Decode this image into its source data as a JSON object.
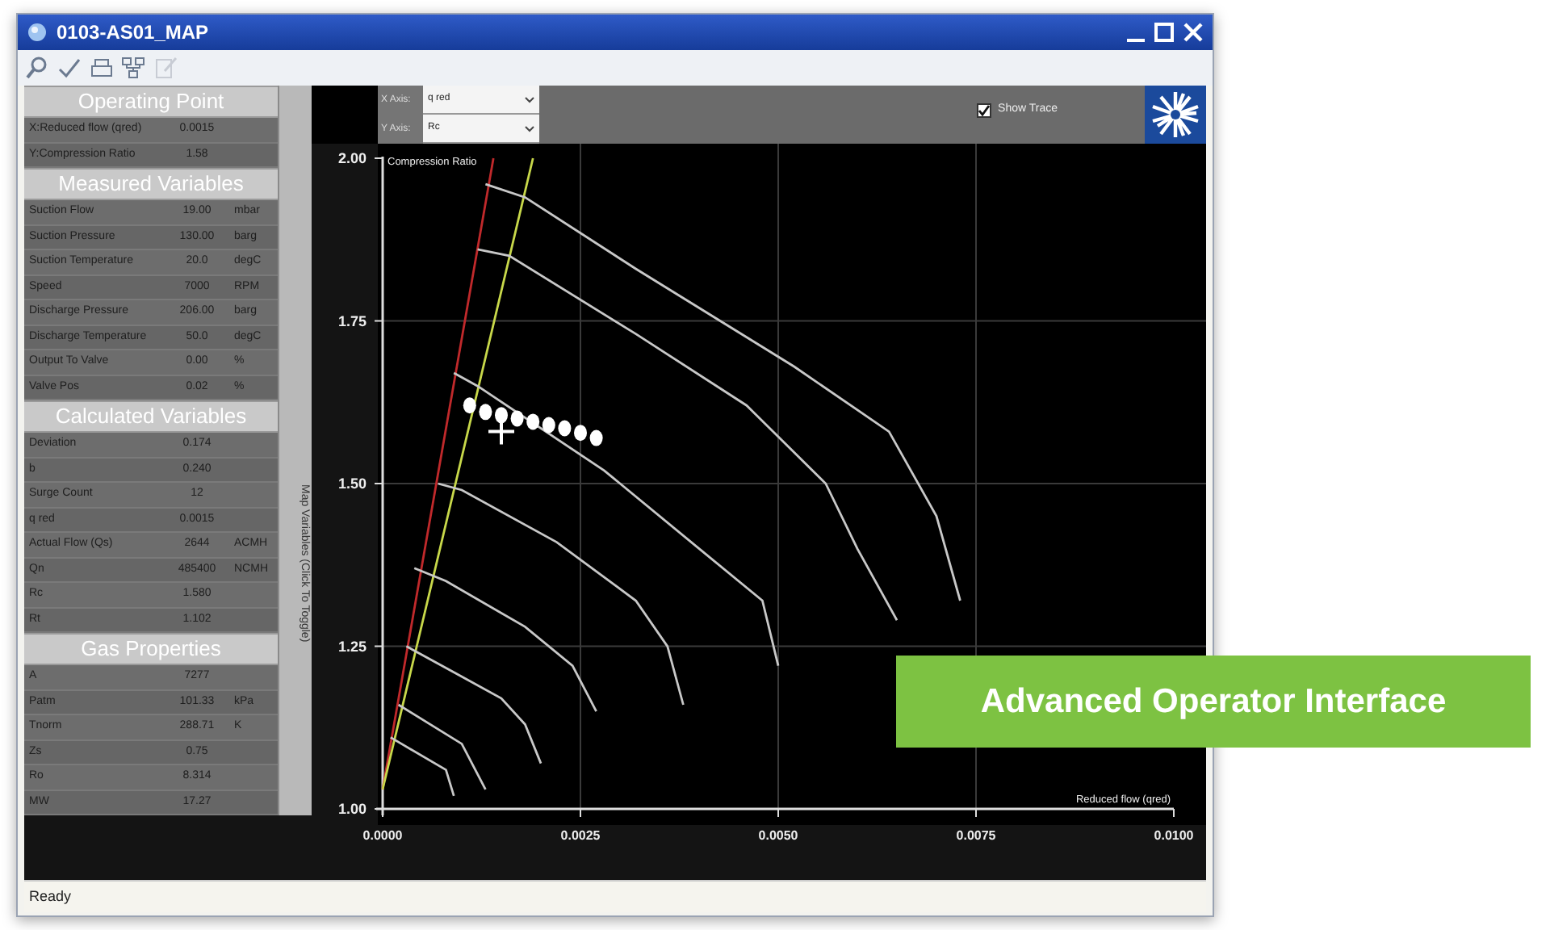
{
  "window": {
    "title": "0103-AS01_MAP"
  },
  "toolbar": [
    {
      "kind": "search",
      "disabled": false
    },
    {
      "kind": "check",
      "disabled": false
    },
    {
      "kind": "print",
      "disabled": false
    },
    {
      "kind": "network",
      "disabled": false
    },
    {
      "kind": "edit",
      "disabled": true
    }
  ],
  "panels": [
    {
      "title": "Operating Point",
      "rows": [
        {
          "label": "X:Reduced flow (qred)",
          "value": "0.0015"
        },
        {
          "label": "Y:Compression Ratio",
          "value": "1.58"
        }
      ]
    },
    {
      "title": "Measured Variables",
      "rows": [
        {
          "label": "Suction Flow",
          "value": "19.00",
          "unit": "mbar"
        },
        {
          "label": "Suction Pressure",
          "value": "130.00",
          "unit": "barg"
        },
        {
          "label": "Suction Temperature",
          "value": "20.0",
          "unit": "degC"
        },
        {
          "label": "Speed",
          "value": "7000",
          "unit": "RPM"
        },
        {
          "label": "Discharge Pressure",
          "value": "206.00",
          "unit": "barg"
        },
        {
          "label": "Discharge Temperature",
          "value": "50.0",
          "unit": "degC"
        },
        {
          "label": "Output To Valve",
          "value": "0.00",
          "unit": "%"
        },
        {
          "label": "Valve Pos",
          "value": "0.02",
          "unit": "%"
        }
      ]
    },
    {
      "title": "Calculated Variables",
      "rows": [
        {
          "label": "Deviation",
          "value": "0.174"
        },
        {
          "label": "b",
          "value": "0.240"
        },
        {
          "label": "Surge Count",
          "value": "12"
        },
        {
          "label": "q red",
          "value": "0.0015"
        },
        {
          "label": "Actual Flow (Qs)",
          "value": "2644",
          "unit": "ACMH"
        },
        {
          "label": "Qn",
          "value": "485400",
          "unit": "NCMH"
        },
        {
          "label": "Rc",
          "value": "1.580"
        },
        {
          "label": "Rt",
          "value": "1.102"
        }
      ]
    },
    {
      "title": "Gas Properties",
      "rows": [
        {
          "label": "A",
          "value": "7277"
        },
        {
          "label": "Patm",
          "value": "101.33",
          "unit": "kPa"
        },
        {
          "label": "Tnorm",
          "value": "288.71",
          "unit": "K"
        },
        {
          "label": "Zs",
          "value": "0.75"
        },
        {
          "label": "Ro",
          "value": "8.314"
        },
        {
          "label": "MW",
          "value": "17.27"
        }
      ]
    }
  ],
  "toggle_bar": {
    "label": "Map Variables (Click To Toggle)"
  },
  "axis_selectors": [
    {
      "label": "X Axis:",
      "value": "q red"
    },
    {
      "label": "Y Axis:",
      "value": "Rc"
    }
  ],
  "show_trace": {
    "label": "Show Trace",
    "checked": true
  },
  "chart_data": {
    "type": "line",
    "xlabel": "Reduced flow (qred)",
    "ylabel": "Compression Ratio",
    "xlim": [
      0,
      0.01
    ],
    "ylim": [
      1,
      2
    ],
    "grid": true,
    "xticks": [
      {
        "value": 0,
        "label": "0.0000"
      },
      {
        "value": 0.0025,
        "label": "0.0025"
      },
      {
        "value": 0.005,
        "label": "0.0050"
      },
      {
        "value": 0.0075,
        "label": "0.0075"
      },
      {
        "value": 0.01,
        "label": "0.0100"
      }
    ],
    "yticks": [
      {
        "value": 1,
        "label": "1.00"
      },
      {
        "value": 1.25,
        "label": "1.25"
      },
      {
        "value": 1.5,
        "label": "1.50"
      },
      {
        "value": 1.75,
        "label": "1.75"
      },
      {
        "value": 2,
        "label": "2.00"
      }
    ],
    "x": [
      0,
      0.0001,
      0.0002,
      0.0003,
      0.0004,
      0.0007,
      0.0008,
      0.0009,
      0.001,
      0.0011,
      0.0012,
      0.0013,
      0.0014,
      0.0015,
      0.0016,
      0.0017,
      0.0018,
      0.0019,
      0.002,
      0.0021,
      0.0022,
      0.0023,
      0.0024,
      0.0025,
      0.0027,
      0.0028,
      0.0032,
      0.0036,
      0.0038,
      0.004,
      0.0046,
      0.0048,
      0.005,
      0.0052,
      0.0056,
      0.006,
      0.0064,
      0.0065,
      0.007,
      0.0073
    ],
    "series": [
      {
        "type": "line",
        "color": "#c0292b",
        "values": [
          1.03,
          null,
          null,
          null,
          null,
          null,
          null,
          null,
          null,
          null,
          null,
          null,
          2.0,
          null,
          null,
          null,
          null,
          null,
          null,
          null,
          null,
          null,
          null,
          null,
          null,
          null,
          null,
          null,
          null,
          null,
          null,
          null,
          null,
          null,
          null,
          null,
          null,
          null,
          null,
          null
        ]
      },
      {
        "type": "line",
        "color": "#c8d84a",
        "values": [
          1.03,
          null,
          null,
          null,
          null,
          null,
          null,
          null,
          null,
          null,
          null,
          null,
          null,
          null,
          null,
          null,
          null,
          2.0,
          null,
          null,
          null,
          null,
          null,
          null,
          null,
          null,
          null,
          null,
          null,
          null,
          null,
          null,
          null,
          null,
          null,
          null,
          null,
          null,
          null,
          null
        ]
      },
      {
        "type": "line",
        "color": "#c8c8c8",
        "values": [
          null,
          null,
          null,
          null,
          null,
          null,
          null,
          null,
          null,
          null,
          null,
          1.96,
          null,
          null,
          null,
          null,
          1.94,
          null,
          null,
          null,
          null,
          null,
          null,
          null,
          null,
          null,
          1.83,
          null,
          null,
          null,
          null,
          null,
          null,
          1.68,
          null,
          null,
          1.58,
          null,
          1.45,
          1.32
        ]
      },
      {
        "type": "line",
        "color": "#c8c8c8",
        "values": [
          null,
          null,
          null,
          null,
          null,
          null,
          null,
          null,
          null,
          null,
          1.86,
          null,
          null,
          null,
          1.85,
          null,
          null,
          null,
          null,
          null,
          null,
          null,
          null,
          null,
          null,
          null,
          1.73,
          null,
          null,
          null,
          1.62,
          null,
          null,
          null,
          1.5,
          1.4,
          null,
          1.29,
          null,
          null
        ]
      },
      {
        "type": "line",
        "color": "#c8c8c8",
        "values": [
          null,
          null,
          null,
          null,
          null,
          null,
          null,
          1.67,
          null,
          null,
          1.65,
          null,
          null,
          null,
          null,
          null,
          null,
          null,
          null,
          null,
          null,
          null,
          null,
          null,
          null,
          1.52,
          null,
          null,
          null,
          1.4,
          null,
          1.32,
          1.22,
          null,
          null,
          null,
          null,
          null,
          null,
          null
        ]
      },
      {
        "type": "line",
        "color": "#c8c8c8",
        "values": [
          null,
          null,
          null,
          null,
          null,
          1.5,
          null,
          null,
          1.49,
          null,
          null,
          null,
          null,
          null,
          null,
          null,
          null,
          null,
          null,
          null,
          1.41,
          null,
          null,
          null,
          null,
          null,
          1.32,
          1.25,
          1.16,
          null,
          null,
          null,
          null,
          null,
          null,
          null,
          null,
          null,
          null,
          null
        ]
      },
      {
        "type": "line",
        "color": "#c8c8c8",
        "values": [
          null,
          null,
          null,
          null,
          1.37,
          null,
          1.35,
          null,
          null,
          null,
          null,
          null,
          null,
          null,
          null,
          null,
          1.28,
          null,
          null,
          null,
          null,
          null,
          1.22,
          null,
          1.15,
          null,
          null,
          null,
          null,
          null,
          null,
          null,
          null,
          null,
          null,
          null,
          null,
          null,
          null,
          null
        ]
      },
      {
        "type": "line",
        "color": "#c8c8c8",
        "values": [
          null,
          null,
          null,
          1.25,
          null,
          null,
          null,
          1.21,
          null,
          null,
          null,
          null,
          null,
          1.17,
          null,
          null,
          1.13,
          null,
          1.07,
          null,
          null,
          null,
          null,
          null,
          null,
          null,
          null,
          null,
          null,
          null,
          null,
          null,
          null,
          null,
          null,
          null,
          null,
          null,
          null,
          null
        ]
      },
      {
        "type": "line",
        "color": "#c8c8c8",
        "values": [
          null,
          null,
          1.16,
          null,
          null,
          null,
          null,
          null,
          1.1,
          null,
          null,
          1.03,
          null,
          null,
          null,
          null,
          null,
          null,
          null,
          null,
          null,
          null,
          null,
          null,
          null,
          null,
          null,
          null,
          null,
          null,
          null,
          null,
          null,
          null,
          null,
          null,
          null,
          null,
          null,
          null
        ]
      },
      {
        "type": "line",
        "color": "#c8c8c8",
        "values": [
          null,
          1.11,
          null,
          null,
          null,
          null,
          1.06,
          1.02,
          null,
          null,
          null,
          null,
          null,
          null,
          null,
          null,
          null,
          null,
          null,
          null,
          null,
          null,
          null,
          null,
          null,
          null,
          null,
          null,
          null,
          null,
          null,
          null,
          null,
          null,
          null,
          null,
          null,
          null,
          null,
          null
        ]
      },
      {
        "type": "scatter",
        "marker": "circle",
        "color": "#ffffff",
        "values": [
          null,
          null,
          null,
          null,
          null,
          null,
          null,
          null,
          null,
          1.62,
          null,
          1.61,
          null,
          1.605,
          null,
          1.6,
          null,
          1.595,
          null,
          1.59,
          null,
          1.585,
          null,
          1.578,
          1.57,
          null,
          null,
          null,
          null,
          null,
          null,
          null,
          null,
          null,
          null,
          null,
          null,
          null,
          null,
          null
        ]
      },
      {
        "type": "scatter",
        "marker": "cross",
        "color": "#ffffff",
        "values": [
          null,
          null,
          null,
          null,
          null,
          null,
          null,
          null,
          null,
          null,
          null,
          null,
          null,
          1.58,
          null,
          null,
          null,
          null,
          null,
          null,
          null,
          null,
          null,
          null,
          null,
          null,
          null,
          null,
          null,
          null,
          null,
          null,
          null,
          null,
          null,
          null,
          null,
          null,
          null,
          null
        ]
      }
    ]
  },
  "banner": {
    "text": "Advanced Operator Interface"
  },
  "status_bar": {
    "text": "Ready"
  }
}
